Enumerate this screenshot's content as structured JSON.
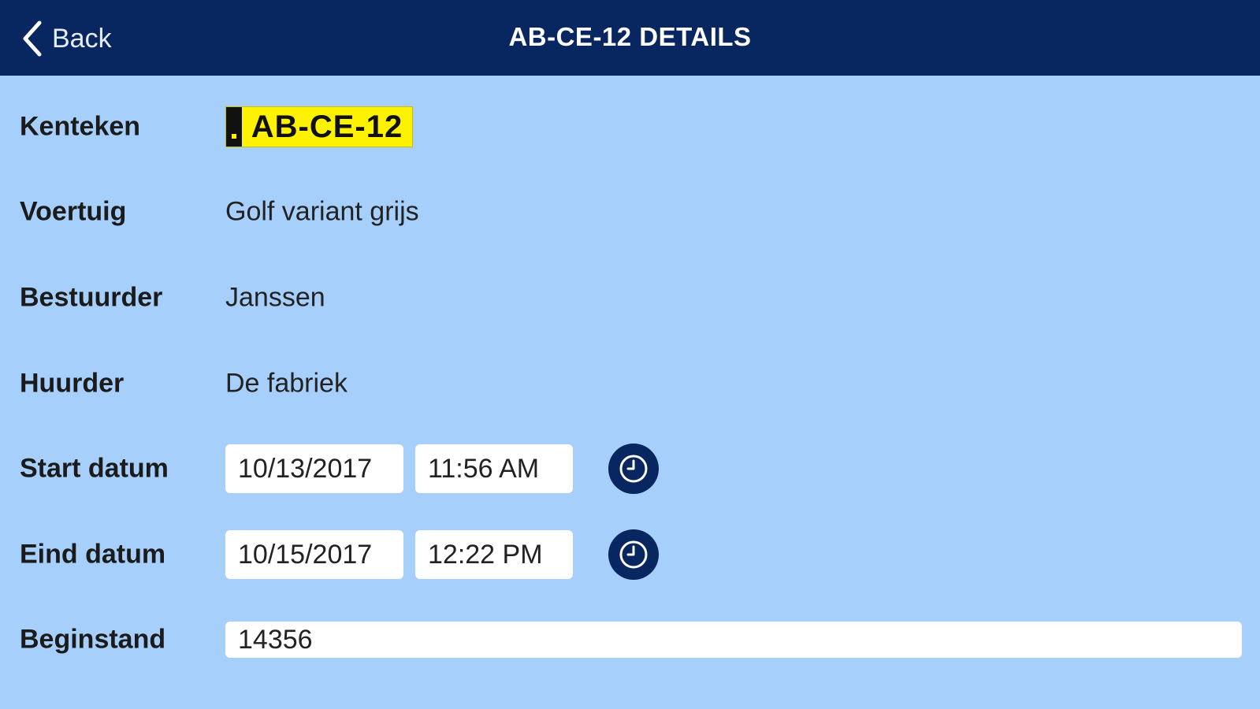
{
  "nav": {
    "back_label": "Back",
    "title": "AB-CE-12 DETAILS"
  },
  "details": {
    "kenteken": {
      "label": "Kenteken",
      "plate": "AB-CE-12"
    },
    "voertuig": {
      "label": "Voertuig",
      "value": "Golf variant grijs"
    },
    "bestuurder": {
      "label": "Bestuurder",
      "value": "Janssen"
    },
    "huurder": {
      "label": "Huurder",
      "value": "De fabriek"
    },
    "start": {
      "label": "Start datum",
      "date": "10/13/2017",
      "time": "11:56 AM"
    },
    "eind": {
      "label": "Eind datum",
      "date": "10/15/2017",
      "time": "12:22 PM"
    },
    "beginstand": {
      "label": "Beginstand",
      "value": "14356"
    }
  },
  "colors": {
    "navbar": "#08265f",
    "background": "#a6cffc",
    "plate": "#fff200",
    "field": "#ffffff"
  },
  "icons": [
    "chevron-left-icon",
    "clock-icon"
  ]
}
